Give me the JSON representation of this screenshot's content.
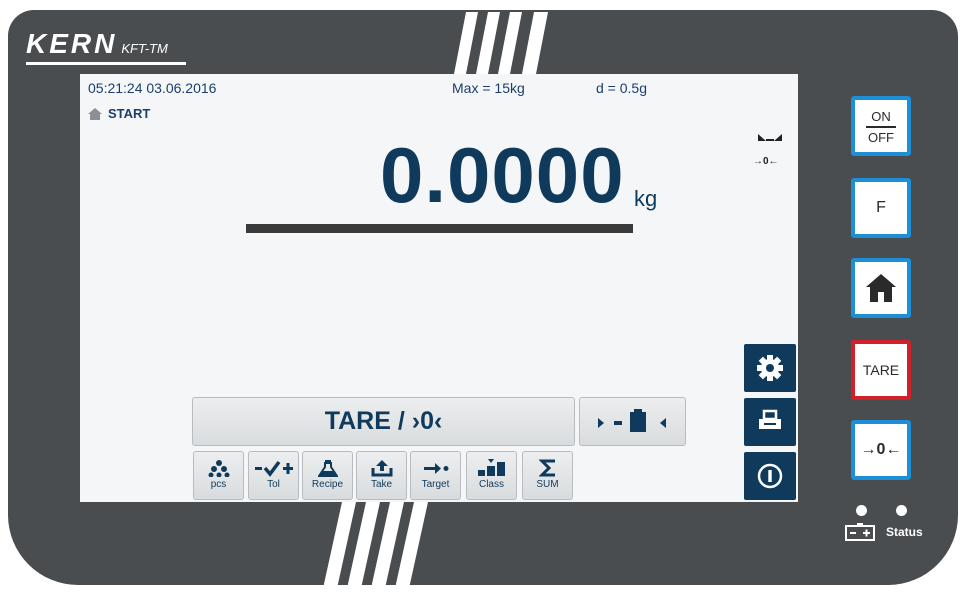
{
  "brand": {
    "logo": "KERN",
    "model": "KFT-TM"
  },
  "screen": {
    "datetime": "05:21:24  03.06.2016",
    "max": "Max = 15kg",
    "d": "d = 0.5g",
    "mode": "START",
    "weight": "0.0000",
    "unit": "kg",
    "zero_indicator": "→0←"
  },
  "actions": {
    "tare_zero_label": "TARE / ›0‹"
  },
  "functions": [
    {
      "label": "pcs",
      "icon": "pieces-icon"
    },
    {
      "label": "Tol",
      "icon": "tolerance-icon"
    },
    {
      "label": "Recipe",
      "icon": "flask-icon"
    },
    {
      "label": "Take",
      "icon": "take-icon"
    },
    {
      "label": "Target",
      "icon": "target-icon"
    },
    {
      "label": "Class",
      "icon": "class-icon"
    },
    {
      "label": "SUM",
      "icon": "sum-icon"
    }
  ],
  "side_buttons": [
    "gear-icon",
    "print-icon",
    "info-icon"
  ],
  "keys": {
    "on": "ON",
    "off": "OFF",
    "f": "F",
    "tare": "TARE",
    "zero": "→0←"
  },
  "status_label": "Status",
  "colors": {
    "accent": "#0f3a5c",
    "key_blue": "#1d8fd6",
    "key_red": "#d0212b",
    "housing": "#4a4d50"
  }
}
